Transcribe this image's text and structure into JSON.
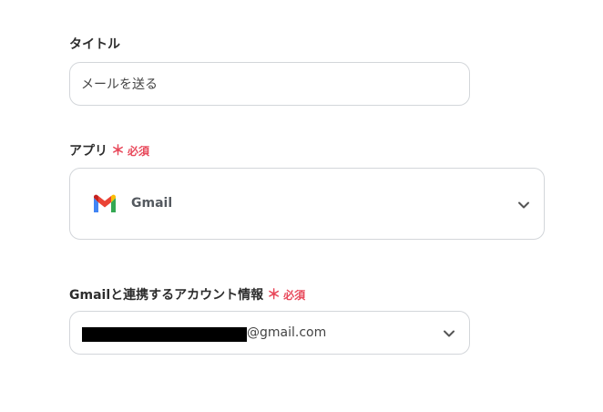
{
  "title_field": {
    "label": "タイトル",
    "value": "メールを送る"
  },
  "app_field": {
    "label": "アプリ",
    "required_mark": "＊",
    "required_text": "必須",
    "selected_app": "Gmail",
    "app_icon": "gmail-icon"
  },
  "account_field": {
    "label": "Gmailと連携するアカウント情報",
    "required_mark": "＊",
    "required_text": "必須",
    "value_suffix": "@gmail.com"
  },
  "colors": {
    "required": "#e8495b",
    "border": "#d3d6da",
    "text": "#2d2d2d"
  }
}
